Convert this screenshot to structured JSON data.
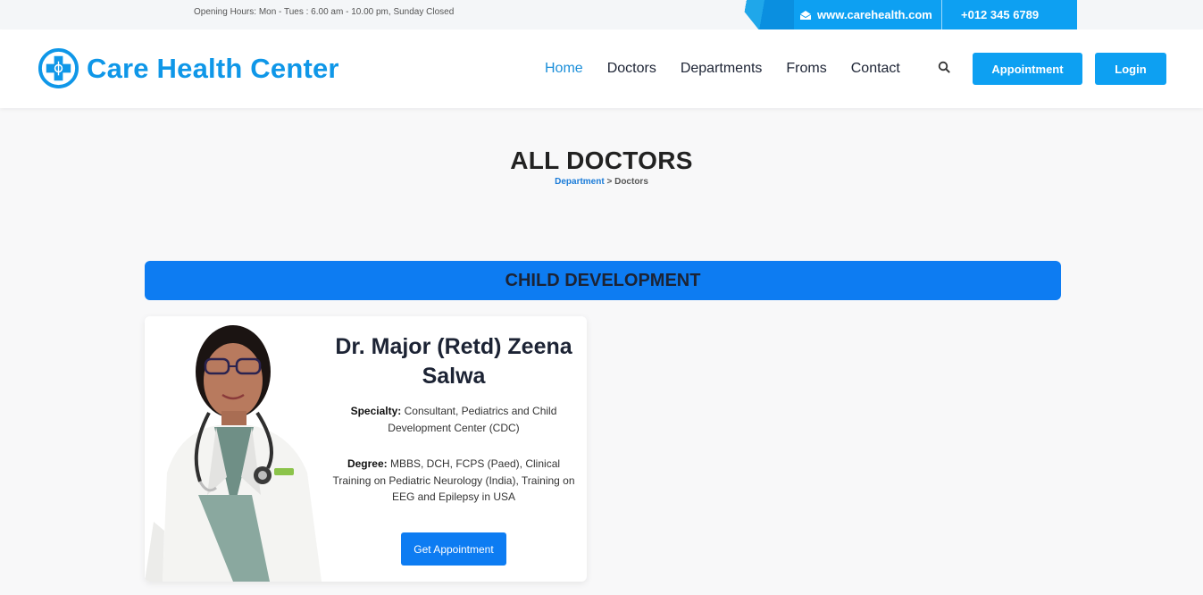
{
  "topbar": {
    "hours": "Opening Hours: Mon - Tues : 6.00 am - 10.00 pm, Sunday Closed",
    "email": "www.carehealth.com",
    "phone": "+012 345 6789"
  },
  "header": {
    "logo_text": "Care Health Center",
    "nav": [
      "Home",
      "Doctors",
      "Departments",
      "Froms",
      "Contact"
    ],
    "active_nav": "Home",
    "appointment_label": "Appointment",
    "login_label": "Login"
  },
  "page": {
    "title": "ALL DOCTORS",
    "breadcrumb_link": "Department",
    "breadcrumb_sep": " > ",
    "breadcrumb_current": "Doctors"
  },
  "department": {
    "name": "CHILD DEVELOPMENT"
  },
  "doctor": {
    "name": "Dr. Major (Retd) Zeena Salwa",
    "specialty_label": "Specialty:",
    "specialty": "Consultant, Pediatrics and Child Development Center (CDC)",
    "degree_label": "Degree:",
    "degree": "MBBS, DCH, FCPS (Paed), Clinical Training on Pediatric Neurology (India), Training on EEG and Epilepsy in USA",
    "button_label": "Get Appointment"
  },
  "colors": {
    "brand": "#0f97e8",
    "primary_button": "#0d7cf2",
    "accent": "#0da0f2"
  }
}
